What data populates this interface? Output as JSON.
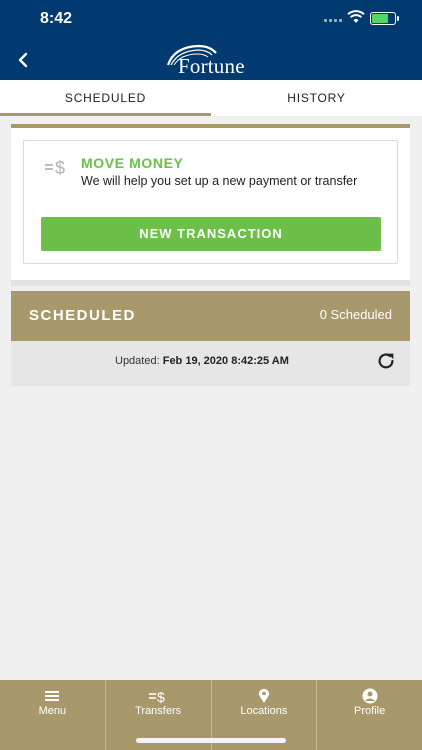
{
  "status_bar": {
    "time": "8:42"
  },
  "header": {
    "logo_text": "Fortune"
  },
  "tabs": [
    {
      "label": "SCHEDULED",
      "active": true
    },
    {
      "label": "HISTORY",
      "active": false
    }
  ],
  "move_money": {
    "title": "MOVE MONEY",
    "description": "We will help you set up a new payment or transfer",
    "button_label": "NEW TRANSACTION"
  },
  "scheduled": {
    "title": "SCHEDULED",
    "count_label": "0 Scheduled",
    "updated_prefix": "Updated:",
    "updated_value": "Feb 19, 2020 8:42:25 AM"
  },
  "bottom_nav": [
    {
      "label": "Menu",
      "icon": "menu-icon"
    },
    {
      "label": "Transfers",
      "icon": "transfers-icon"
    },
    {
      "label": "Locations",
      "icon": "location-pin-icon"
    },
    {
      "label": "Profile",
      "icon": "profile-icon"
    }
  ],
  "colors": {
    "header_blue": "#003a70",
    "accent_gold": "#a8996c",
    "action_green": "#6cc04a",
    "background": "#f0f0f0"
  }
}
